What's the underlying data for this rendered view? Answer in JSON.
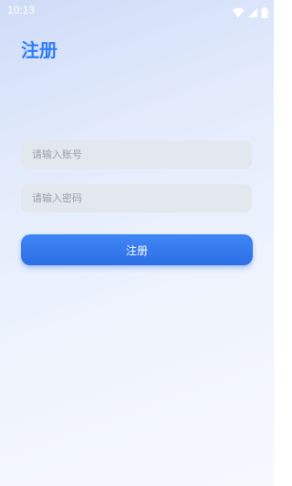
{
  "status_bar": {
    "time": "10:13",
    "icons": [
      "wifi-icon",
      "signal-icon",
      "battery-icon"
    ]
  },
  "page": {
    "title": "注册"
  },
  "form": {
    "account_placeholder": "请输入账号",
    "password_placeholder": "请输入密码",
    "submit_label": "注册"
  },
  "colors": {
    "accent": "#2f7df6",
    "button": "#3a7df0",
    "field_background": "#e3e7ee",
    "placeholder": "#9aa0aa"
  }
}
